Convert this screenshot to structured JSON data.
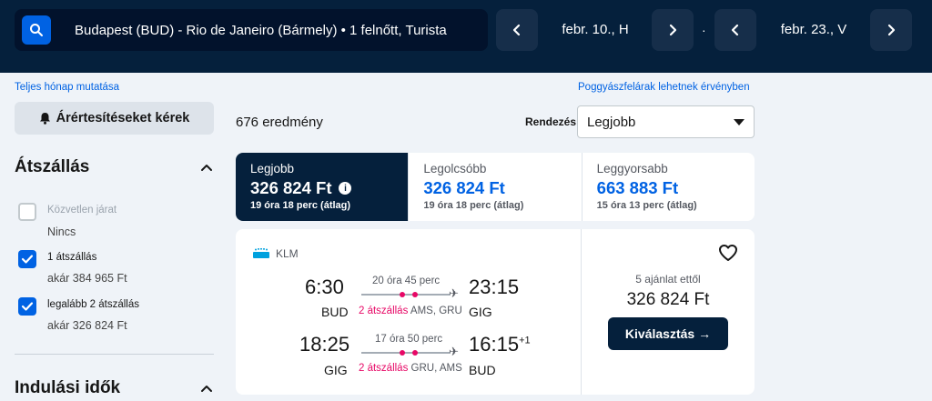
{
  "header": {
    "search_summary": "Budapest (BUD) - Rio de Janeiro (Bármely)  •  1 felnőtt, Turista",
    "depart_date": "febr. 10., H",
    "return_date": "febr. 23., V",
    "separator": "·"
  },
  "links": {
    "full_month": "Teljes hónap mutatása",
    "baggage": "Poggyászfelárak lehetnek érvényben"
  },
  "sidebar": {
    "alert_button": "Árértesítéseket kérek",
    "stops_title": "Átszállás",
    "filters": [
      {
        "label": "Közvetlen járat",
        "sub": "Nincs",
        "checked": false
      },
      {
        "label": "1 átszállás",
        "sub": "akár 384 965 Ft",
        "checked": true
      },
      {
        "label": "legalább 2 átszállás",
        "sub": "akár 326 824 Ft",
        "checked": true
      }
    ],
    "departure_title": "Indulási idők"
  },
  "results": {
    "count": "676 eredmény",
    "sort_label": "Rendezés",
    "sort_value": "Legjobb"
  },
  "tabs": [
    {
      "title": "Legjobb",
      "price": "326 824 Ft",
      "sub": "19 óra 18 perc (átlag)"
    },
    {
      "title": "Legolcsóbb",
      "price": "326 824 Ft",
      "sub": "19 óra 18 perc (átlag)"
    },
    {
      "title": "Leggyorsabb",
      "price": "663 883 Ft",
      "sub": "15 óra 13 perc (átlag)"
    }
  ],
  "card": {
    "airline": "KLM",
    "legs": [
      {
        "dep_time": "6:30",
        "arr_time": "23:15",
        "arr_plus": "",
        "dep_code": "BUD",
        "arr_code": "GIG",
        "duration": "20 óra 45 perc",
        "stops_count": "2 átszállás",
        "stops_airports": "AMS, GRU"
      },
      {
        "dep_time": "18:25",
        "arr_time": "16:15",
        "arr_plus": "+1",
        "dep_code": "GIG",
        "arr_code": "BUD",
        "duration": "17 óra 50 perc",
        "stops_count": "2 átszállás",
        "stops_airports": "GRU, AMS"
      }
    ],
    "offers": "5 ajánlat ettől",
    "price": "326 824 Ft",
    "select_label": "Kiválasztás →"
  },
  "colors": {
    "header_bg": "#05203c",
    "accent_blue": "#0062e3",
    "stop_pink": "#e70866",
    "page_bg": "#eff3f8"
  }
}
